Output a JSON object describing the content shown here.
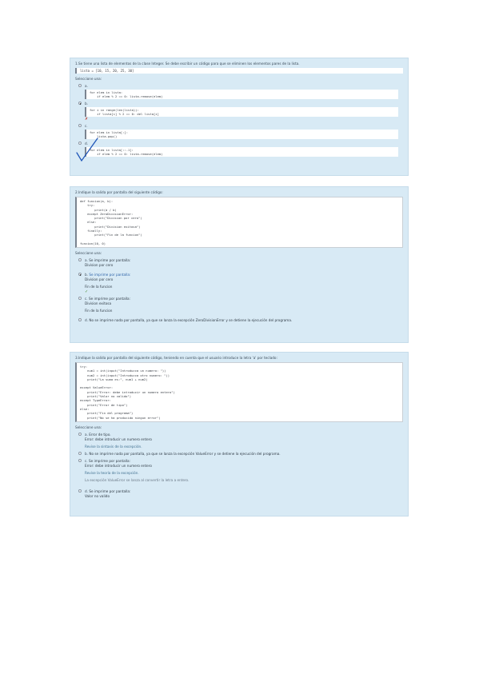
{
  "q1": {
    "title": "1.Se tiene una lista de elementos de la clase Integer. Se debe escribir un código para que se eliminen los elementos pares de la lista.",
    "given_code": "lista = [10, 15, 20, 25, 30]",
    "select_label": "Seleccione una:",
    "options": [
      {
        "letter": "a.",
        "code": "for elem in lista:\n    if elem % 2 == 0: lista.remove(elem)"
      },
      {
        "letter": "b.",
        "code": "for i in range(len(lista)):\n    if lista[i] % 2 == 0: del lista[i]"
      },
      {
        "letter": "c.",
        "code": "for elem in lista[:]:\n    lista.pop()"
      },
      {
        "letter": "d.",
        "code": "for elem in lista[::-1]:\n    if elem % 2 == 0: lista.remove(elem)"
      }
    ],
    "wrong_mark": "✗",
    "right_mark": "✓"
  },
  "q2": {
    "title": "2.Indique la salida por pantalla del siguiente código:",
    "code": "def funcion(a, b):\n    try:\n        print(a / b)\n    except ZeroDivisionError:\n        print(\"Division por cero\")\n    else:\n        print(\"Division exitosa\")\n    finally:\n        print(\"Fin de la funcion\")\n\nfuncion(10, 0)",
    "select_label": "Seleccione una:",
    "options": [
      {
        "letter": "a.",
        "text": "Se imprime por pantalla:",
        "detail": "Division por cero"
      },
      {
        "letter": "b.",
        "text": "Se imprime por pantalla:",
        "detail": "Division por cero"
      },
      {
        "letter": "c.",
        "text": "Se imprime por pantalla:",
        "detail": "Division exitosa"
      },
      {
        "letter": "d.",
        "text": "No se imprime nada por pantalla, ya que se lanza la excepción ZeroDivisionError y se detiene la ejecución del programa."
      }
    ],
    "after_b": "Fin de la funcion",
    "after_c": "Fin de la funcion",
    "check": "✓"
  },
  "q3": {
    "title": "3.Indique la salida por pantalla del siguiente código, teniendo en cuenta que el usuario introduce la letra 'a' por teclado:",
    "code": "try:\n    num1 = int(input(\"Introduzca un numero: \"))\n    num2 = int(input(\"Introduzca otro numero: \"))\n    print(\"La suma es:\", num1 + num2)\n\nexcept ValueError:\n    print(\"Error: debe introducir un numero entero\")\n    print(\"Valor no valido\")\nexcept TypeError:\n    print(\"Error de tipo\")\nelse:\n    print(\"Fin del programa\")\n    print(\"No se ha producido ningun error\")",
    "select_label": "Seleccione una:",
    "options": [
      {
        "letter": "a.",
        "text": "Error de tipo.",
        "detail": "Error: debe introducir un numero entero"
      },
      {
        "letter": "b.",
        "text": "No se imprime nada por pantalla, ya que se lanza la excepción ValueError y se detiene la ejecución del programa."
      },
      {
        "letter": "c.",
        "text": "Se imprime por pantalla:",
        "detail": "Error: debe introducir un numero entero"
      },
      {
        "letter": "d.",
        "text": "Se imprime por pantalla:",
        "detail": "Valor no valido"
      }
    ],
    "feedback_a": "Revise la sintaxis de la excepción.",
    "feedback_c": "Revise la teoría de la excepción.",
    "feedback_c2": "La excepción ValueError se lanza al convertir la letra a entero."
  }
}
